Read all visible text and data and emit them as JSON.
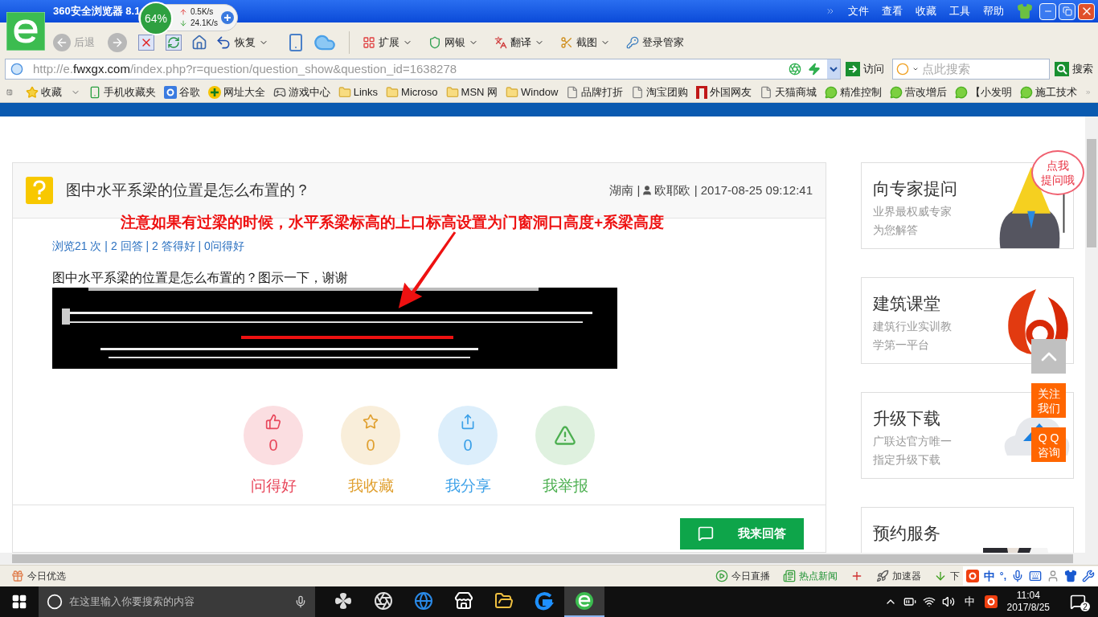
{
  "window": {
    "title": "360安全浏览器 8.1",
    "menu": [
      "文件",
      "查看",
      "收藏",
      "工具",
      "帮助"
    ]
  },
  "speed_widget": {
    "percent": "64%",
    "upload": "0.5K/s",
    "download": "24.1K/s"
  },
  "toolbar": {
    "back": "后退",
    "restore": "恢复",
    "extend": "扩展",
    "bank": "网银",
    "translate": "翻译",
    "screenshot": "截图",
    "login": "登录管家"
  },
  "address_bar": {
    "url_prefix": "http://e.",
    "url_domain": "fwxgx.com",
    "url_path": "/index.php?r=question/question_show&question_id=1638278",
    "go": "访问",
    "search_placeholder": "点此搜索",
    "search_button": "搜索"
  },
  "bookmarks": [
    {
      "label": "收藏",
      "kind": "star"
    },
    {
      "label": "手机收藏夹",
      "kind": "phone"
    },
    {
      "label": "谷歌",
      "kind": "g"
    },
    {
      "label": "网址大全",
      "kind": "plus"
    },
    {
      "label": "游戏中心",
      "kind": "game"
    },
    {
      "label": "Links",
      "kind": "folder"
    },
    {
      "label": "Microso",
      "kind": "folder"
    },
    {
      "label": "MSN 网",
      "kind": "folder"
    },
    {
      "label": "Window",
      "kind": "folder"
    },
    {
      "label": "品牌打折",
      "kind": "page"
    },
    {
      "label": "淘宝团购",
      "kind": "page"
    },
    {
      "label": "外国网友",
      "kind": "red"
    },
    {
      "label": "天猫商城",
      "kind": "page"
    },
    {
      "label": "精准控制",
      "kind": "chat"
    },
    {
      "label": "营改增后",
      "kind": "chat"
    },
    {
      "label": "【小发明",
      "kind": "chat"
    },
    {
      "label": "施工技术",
      "kind": "chat"
    }
  ],
  "question": {
    "title": "图中水平系梁的位置是怎么布置的？",
    "region": "湖南 |",
    "author_time": "欧耶欧 | 2017-08-25 09:12:41",
    "stats": "浏览21 次 | 2 回答 | 2 答得好 | 0问得好",
    "body": "图中水平系梁的位置是怎么布置的？图示一下，谢谢"
  },
  "annotation": "注意如果有过梁的时候，水平系梁标高的上口标高设置为门窗洞口高度+系梁高度",
  "actions": [
    {
      "kind": "like",
      "count": "0",
      "label": "问得好",
      "color": "#e8475b"
    },
    {
      "kind": "star",
      "count": "0",
      "label": "我收藏",
      "color": "#e0a030"
    },
    {
      "kind": "share",
      "count": "0",
      "label": "我分享",
      "color": "#3ba0e8"
    },
    {
      "kind": "report",
      "label": "我举报",
      "color": "#4caf50"
    }
  ],
  "answer_button": "我来回答",
  "sidebar": [
    {
      "kind": "expert",
      "title": "向专家提问",
      "subtitle": [
        "业界最权威专家",
        "为您解答"
      ]
    },
    {
      "kind": "logo",
      "title": "建筑课堂",
      "subtitle": [
        "建筑行业实训教",
        "学第一平台"
      ]
    },
    {
      "kind": "cloud",
      "title": "升级下载",
      "subtitle": [
        "广联达官方唯一",
        "指定升级下载"
      ]
    },
    {
      "title": "预约服务"
    }
  ],
  "bubble": [
    "点我",
    "提问哦"
  ],
  "float_buttons": [
    {
      "kind": "top"
    },
    {
      "kind": "text",
      "lines": [
        "关注",
        "我们"
      ]
    },
    {
      "kind": "text",
      "lines": [
        "Q Q",
        "咨询"
      ]
    }
  ],
  "status_bar": {
    "left": "今日优选",
    "items": [
      {
        "kind": "play",
        "label": "今日直播"
      },
      {
        "kind": "news",
        "label": "热点新闻"
      },
      {
        "kind": "cross"
      },
      {
        "kind": "rocket",
        "label": "加速器"
      },
      {
        "kind": "download",
        "label": "下"
      }
    ],
    "ime_lang": "中",
    "ime_punct": "°,"
  },
  "taskbar": {
    "search_placeholder": "在这里输入你要搜索的内容",
    "apps": [
      {
        "kind": "fan",
        "selected": false
      },
      {
        "kind": "swirl",
        "selected": false
      },
      {
        "kind": "edge",
        "selected": false
      },
      {
        "kind": "store",
        "selected": false
      },
      {
        "kind": "explorer",
        "selected": false
      },
      {
        "kind": "glodon",
        "selected": false
      },
      {
        "kind": "browser",
        "selected": true
      }
    ],
    "ime": "中",
    "time": "11:04",
    "date": "2017/8/25",
    "notifications": "2"
  }
}
